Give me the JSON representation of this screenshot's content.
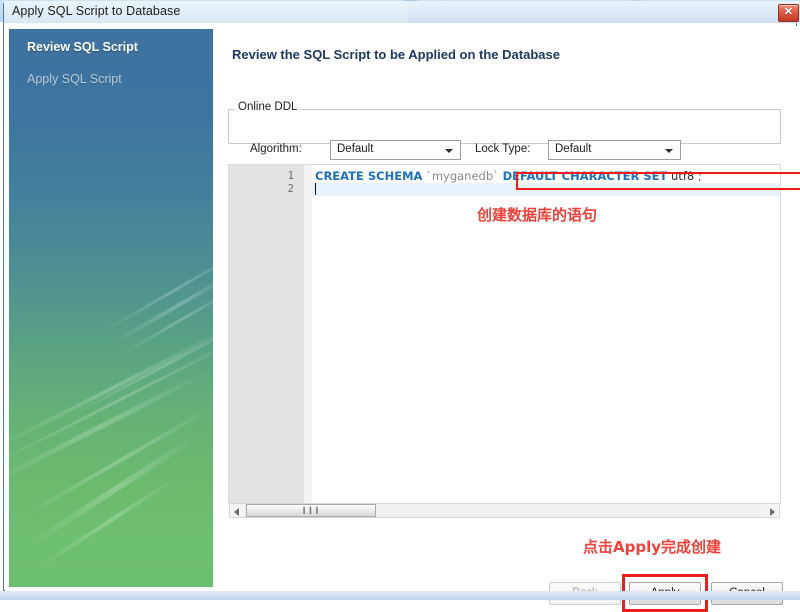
{
  "window": {
    "title": "Apply SQL Script to Database",
    "close_icon": "close-icon",
    "close_glyph": "✕"
  },
  "sidebar": {
    "steps": [
      {
        "label": "Review SQL Script",
        "state": "active"
      },
      {
        "label": "Apply SQL Script",
        "state": "inactive"
      }
    ]
  },
  "content": {
    "heading": "Review the SQL Script to be Applied on the Database",
    "online_ddl": {
      "legend": "Online DDL",
      "algorithm_label": "Algorithm:",
      "algorithm_value": "Default",
      "lock_type_label": "Lock Type:",
      "lock_type_value": "Default",
      "dropdown_icon": "chevron-down-icon"
    },
    "editor": {
      "line_numbers": [
        "1",
        "2"
      ],
      "sql": {
        "full_text": "CREATE SCHEMA `myganedb` DEFAULT CHARACTER SET utf8 ;",
        "tokens": [
          {
            "text": "CREATE SCHEMA",
            "type": "keyword"
          },
          {
            "text": " `myganedb` ",
            "type": "identifier"
          },
          {
            "text": "DEFAULT CHARACTER SET",
            "type": "keyword"
          },
          {
            "text": " utf8 ",
            "type": "literal"
          },
          {
            "text": ";",
            "type": "punctuation"
          }
        ]
      },
      "scrollbar": {
        "left_arrow_icon": "arrow-left-icon",
        "right_arrow_icon": "arrow-right-icon",
        "grip_glyph": "❙❙❙"
      }
    }
  },
  "annotations": [
    {
      "id": "sql",
      "text": "创建数据库的语句"
    },
    {
      "id": "apply",
      "text": "点击Apply完成创建"
    }
  ],
  "footer": {
    "back_label": "Back",
    "back_mnemonic": "B",
    "back_rest": "ack",
    "apply_label": "Apply",
    "cancel_label": "Cancel"
  },
  "colors": {
    "accent_blue": "#1f3864",
    "sidebar_top": "#3e72a0",
    "sidebar_bottom": "#6dbf70",
    "annotation_red": "#f0423a",
    "highlight_red": "#ee1c1c",
    "keyword_blue": "#1d6fbf"
  }
}
